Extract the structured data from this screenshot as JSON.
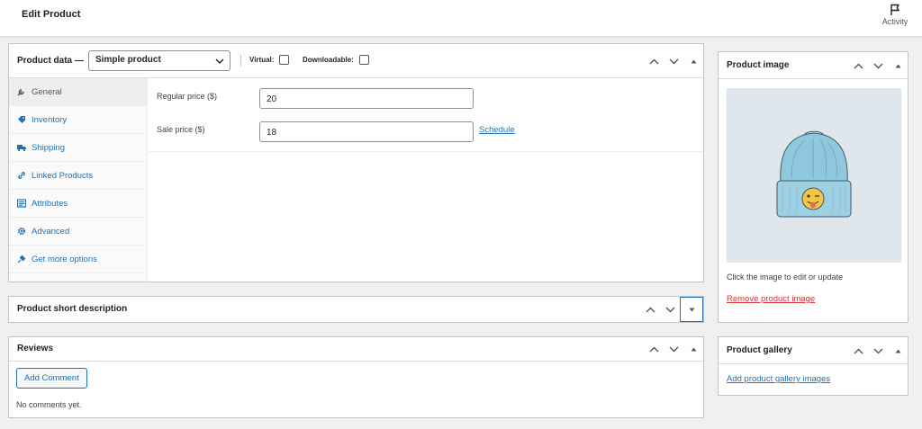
{
  "topbar": {
    "title": "Edit Product",
    "activity_label": "Activity"
  },
  "product_data": {
    "heading": "Product data —",
    "type_select": "Simple product",
    "virtual_label": "Virtual:",
    "downloadable_label": "Downloadable:",
    "tabs": [
      {
        "label": "General",
        "icon": "wrench-icon",
        "active": true
      },
      {
        "label": "Inventory",
        "icon": "tag-icon"
      },
      {
        "label": "Shipping",
        "icon": "truck-icon"
      },
      {
        "label": "Linked Products",
        "icon": "link-icon"
      },
      {
        "label": "Attributes",
        "icon": "list-icon"
      },
      {
        "label": "Advanced",
        "icon": "gear-icon"
      },
      {
        "label": "Get more options",
        "icon": "plugin-icon"
      }
    ],
    "regular_price_label": "Regular price ($)",
    "regular_price_value": "20",
    "sale_price_label": "Sale price ($)",
    "sale_price_value": "18",
    "schedule_link": "Schedule"
  },
  "short_description": {
    "heading": "Product short description"
  },
  "reviews": {
    "heading": "Reviews",
    "add_comment": "Add Comment",
    "empty_text": "No comments yet."
  },
  "product_image": {
    "heading": "Product image",
    "hint": "Click the image to edit or update",
    "remove_link": "Remove product image"
  },
  "product_gallery": {
    "heading": "Product gallery",
    "add_link": "Add product gallery images"
  },
  "colors": {
    "accent": "#2271b1",
    "danger": "#d63638",
    "border": "#c3c4c7",
    "background": "#f0f0f1"
  }
}
